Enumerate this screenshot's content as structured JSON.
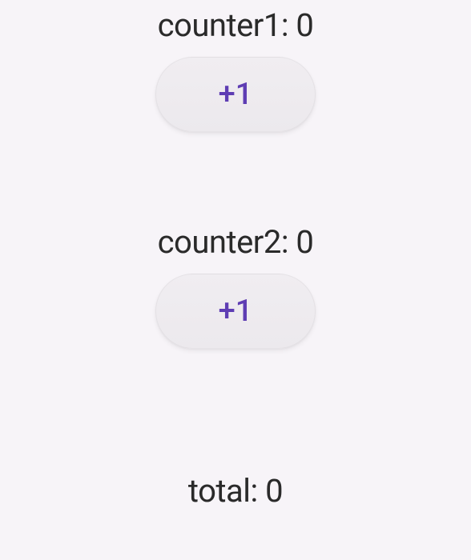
{
  "counter1": {
    "label": "counter1: 0",
    "button_label": "+1"
  },
  "counter2": {
    "label": "counter2: 0",
    "button_label": "+1"
  },
  "total": {
    "label": "total: 0"
  }
}
